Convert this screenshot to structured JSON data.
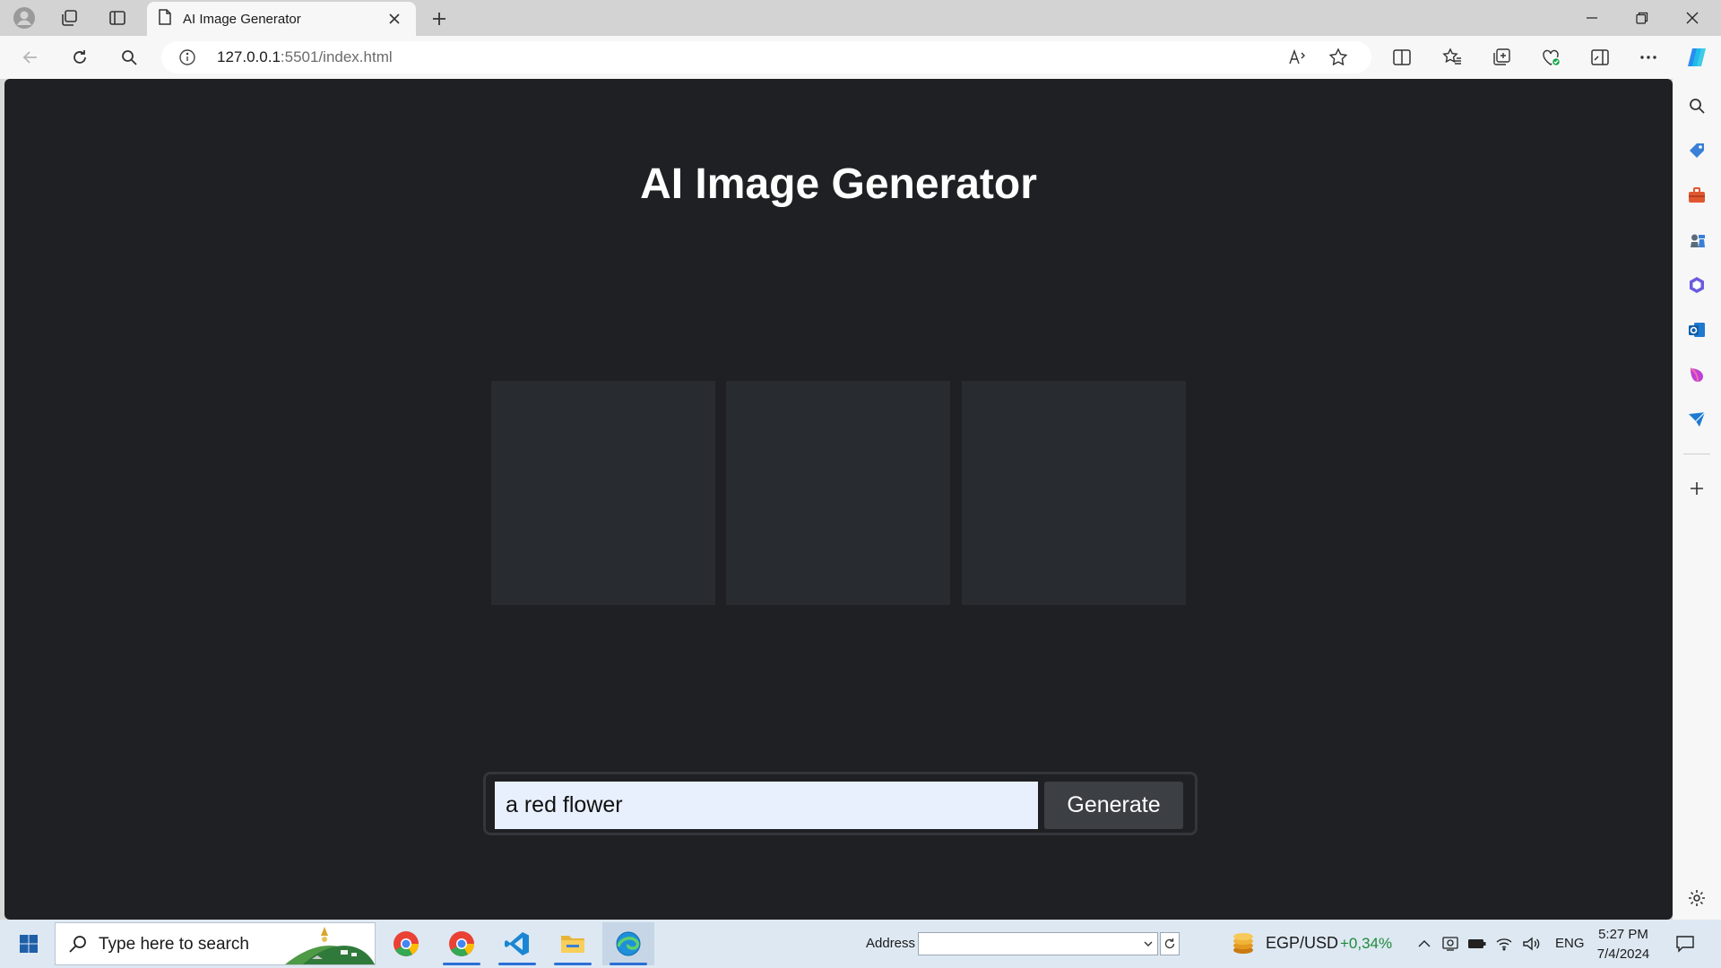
{
  "browser": {
    "tab_title": "AI Image Generator",
    "url_host": "127.0.0.1",
    "url_rest": ":5501/index.html"
  },
  "page": {
    "title": "AI Image Generator",
    "image_slots": 3,
    "prompt_value": "a red flower",
    "generate_label": "Generate"
  },
  "taskbar": {
    "search_placeholder": "Type here to search",
    "address_label": "Address",
    "address_value": "",
    "ticker_name": "EGP/USD",
    "ticker_change": "+0,34%",
    "language": "ENG",
    "time": "5:27 PM",
    "date": "7/4/2024"
  },
  "colors": {
    "page_bg": "#1e2023",
    "image_placeholder": "#282b30",
    "button_bg": "#3c3f44",
    "input_bg": "#e8f0fe",
    "ticker_positive": "#1f8a3a"
  }
}
